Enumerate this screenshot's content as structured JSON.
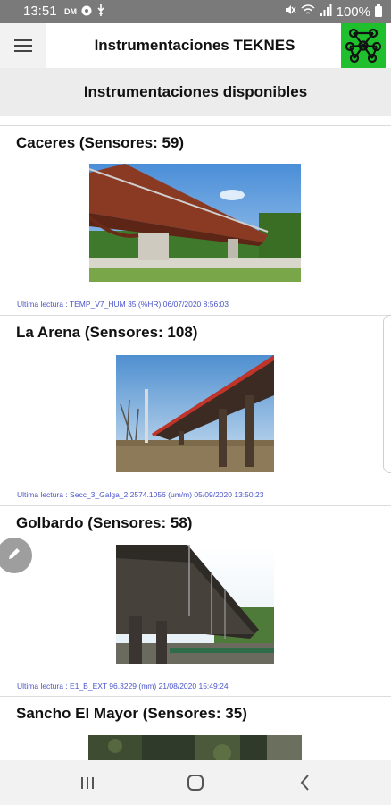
{
  "status_bar": {
    "time": "13:51",
    "battery": "100%",
    "icons": [
      "data-saver-icon",
      "chat-icon",
      "usb-icon",
      "mute-icon",
      "wifi-icon",
      "signal-icon",
      "battery-icon"
    ]
  },
  "app_bar": {
    "title": "Instrumentaciones TEKNES",
    "menu_icon": "hamburger-menu-icon",
    "logo_icon": "network-logo-icon",
    "logo_color": "#1fbf2e"
  },
  "section": {
    "title": "Instrumentaciones disponibles"
  },
  "instrumentations": [
    {
      "name": "Caceres (Sensores: 59)",
      "image": "bridge-photo-caceres",
      "last_reading": "Ultima lectura : TEMP_V7_HUM 35 (%HR) 06/07/2020 8:56:03"
    },
    {
      "name": "La Arena (Sensores: 108)",
      "image": "bridge-photo-la-arena",
      "last_reading": "Ultima lectura : Secc_3_Galga_2 2574.1056 (um/m) 05/09/2020 13:50:23"
    },
    {
      "name": "Golbardo (Sensores: 58)",
      "image": "bridge-photo-golbardo",
      "last_reading": "Ultima lectura : E1_B_EXT 96.3229 (mm) 21/08/2020 15:49:24"
    },
    {
      "name": "Sancho El Mayor (Sensores: 35)",
      "image": "bridge-photo-sancho-el-mayor",
      "last_reading": ""
    }
  ],
  "fab": {
    "icon": "edit-pencil-icon"
  },
  "nav_bar": {
    "recents_icon": "recents-icon",
    "home_icon": "home-icon",
    "back_icon": "back-icon"
  }
}
